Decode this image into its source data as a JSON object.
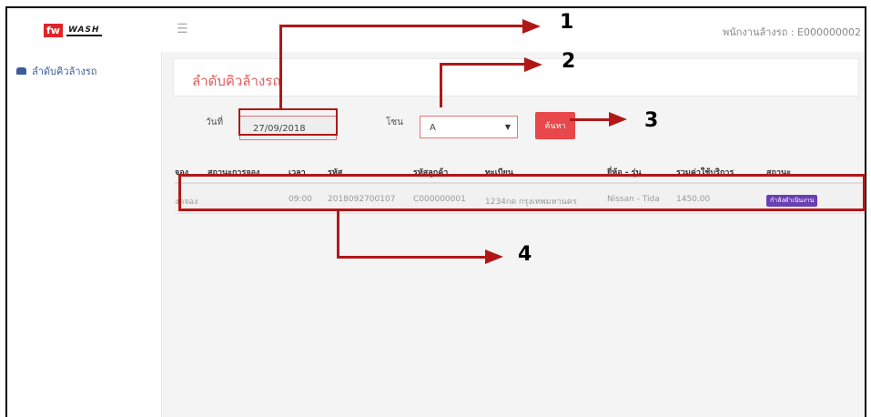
{
  "header": {
    "logo_badge": "fw",
    "logo_wordmark": "WASH",
    "menu_icon": "hamburger-icon",
    "user_label": "พนักงานล้างรถ : E000000002"
  },
  "sidebar": {
    "items": [
      {
        "icon": "car-icon",
        "label": "ลำดับคิวล้างรถ"
      }
    ]
  },
  "main": {
    "title": "ลำดับคิวล้างรถ",
    "date_label": "วันที่",
    "date_value": "27/09/2018",
    "zone_label": "โซน",
    "zone_value": "A",
    "search_label": "ค้นหา",
    "columns": [
      "จอง",
      "สถานะการจอง",
      "เวลา",
      "รหัส",
      "รหัสลูกค้า",
      "ทะเบียน",
      "ยี่ห้อ - รุ่น",
      "รวมค่าใช้บริการ",
      "สถานะ"
    ],
    "rows": [
      {
        "booking": "งดจอง",
        "booking_status": "",
        "time": "09:00",
        "code": "2018092700107",
        "customer_code": "C000000001",
        "plate": "1234กด กรุงเทพมหานคร",
        "brand_model": "Nissan - Tida",
        "total": "1450.00",
        "status": "กำลังดำเนินงาน"
      }
    ]
  },
  "annotations": {
    "labels": [
      "1",
      "2",
      "3",
      "4"
    ],
    "color": "#b01818"
  },
  "colors": {
    "accent": "#e8474b",
    "title": "#e05d5d",
    "status_badge": "#6a3fb5",
    "sidebar_link": "#3b5c9a"
  }
}
